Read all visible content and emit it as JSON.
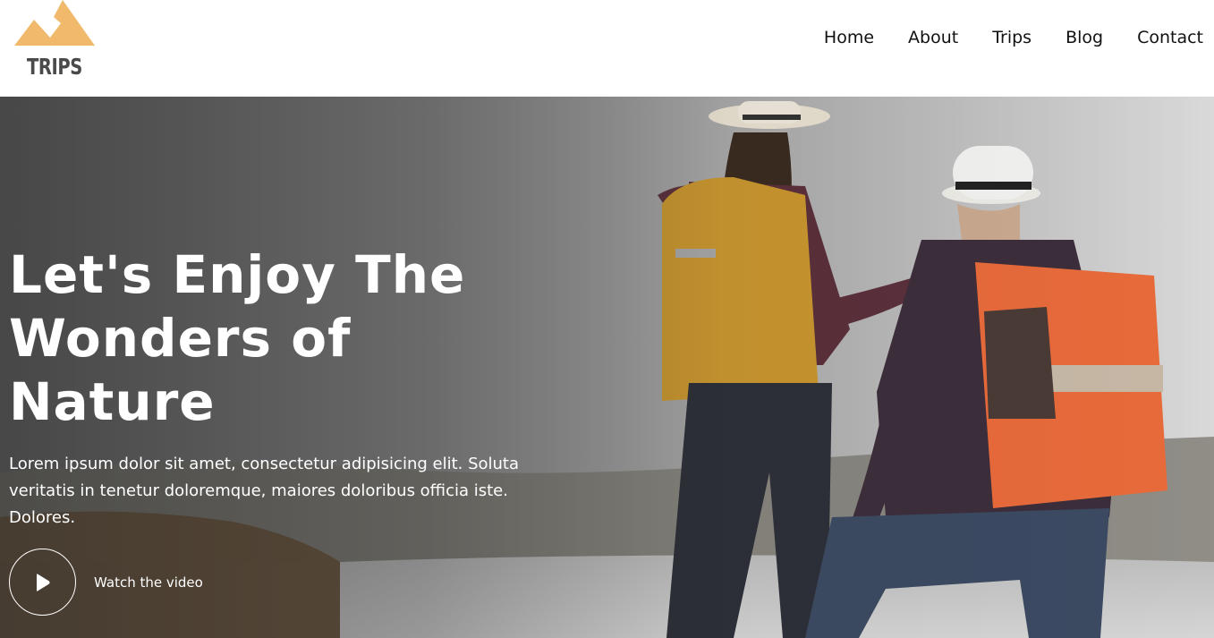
{
  "brand": {
    "name": "TRIPS",
    "logo_icon": "mountain-icon",
    "logo_color": "#F0B96B"
  },
  "nav": {
    "items": [
      {
        "label": "Home"
      },
      {
        "label": "About"
      },
      {
        "label": "Trips"
      },
      {
        "label": "Blog"
      },
      {
        "label": "Contact"
      }
    ]
  },
  "hero": {
    "title_lines": [
      "Let's Enjoy The",
      "Wonders of",
      "Nature"
    ],
    "description": "Lorem ipsum dolor sit amet, consectetur adipisicing elit. Soluta veritatis in tenetur doloremque, maiores doloribus officia iste. Dolores.",
    "video_label": "Watch the video",
    "video_icon": "play-icon",
    "image_subject": "hikers-with-backpacks-photo"
  }
}
